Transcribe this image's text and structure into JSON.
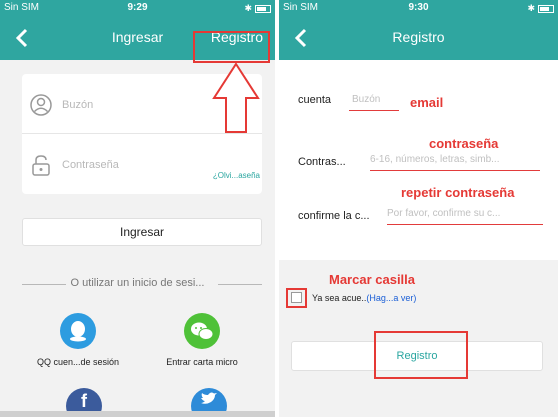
{
  "colors": {
    "primary": "#2fa6a0",
    "annotation": "#e53935",
    "background": "#f2f2f2",
    "link": "#1b5fd6",
    "qq": "#2d9ce0",
    "wechat": "#4fc138",
    "facebook": "#3b5b9c",
    "twitter": "#2e8bd8"
  },
  "left": {
    "status": {
      "carrier": "Sin SIM",
      "time": "9:29"
    },
    "nav": {
      "title": "Ingresar",
      "action": "Registro"
    },
    "login": {
      "email_placeholder": "Buzón",
      "password_placeholder": "Contraseña",
      "forgot": "¿Olvi...aseña",
      "button": "Ingresar"
    },
    "divider": "O utilizar un inicio de sesi...",
    "social": [
      {
        "label": "QQ cuen...de sesión",
        "icon": "qq-icon"
      },
      {
        "label": "Entrar carta micro",
        "icon": "wechat-icon"
      }
    ]
  },
  "right": {
    "status": {
      "carrier": "Sin SIM",
      "time": "9:30"
    },
    "nav": {
      "title": "Registro"
    },
    "form": {
      "account_label": "cuenta",
      "account_placeholder": "Buzón",
      "password_label": "Contras...",
      "password_placeholder": "6-16, números, letras, simb...",
      "confirm_label": "confirme la c...",
      "confirm_placeholder": "Por favor, confirme su c..."
    },
    "agree": {
      "text": "Ya sea acue..",
      "link": "(Hag...a ver)"
    },
    "button": "Registro"
  },
  "annotations": {
    "email": "email",
    "password": "contraseña",
    "repeat": "repetir contraseña",
    "checkbox": "Marcar casilla"
  }
}
